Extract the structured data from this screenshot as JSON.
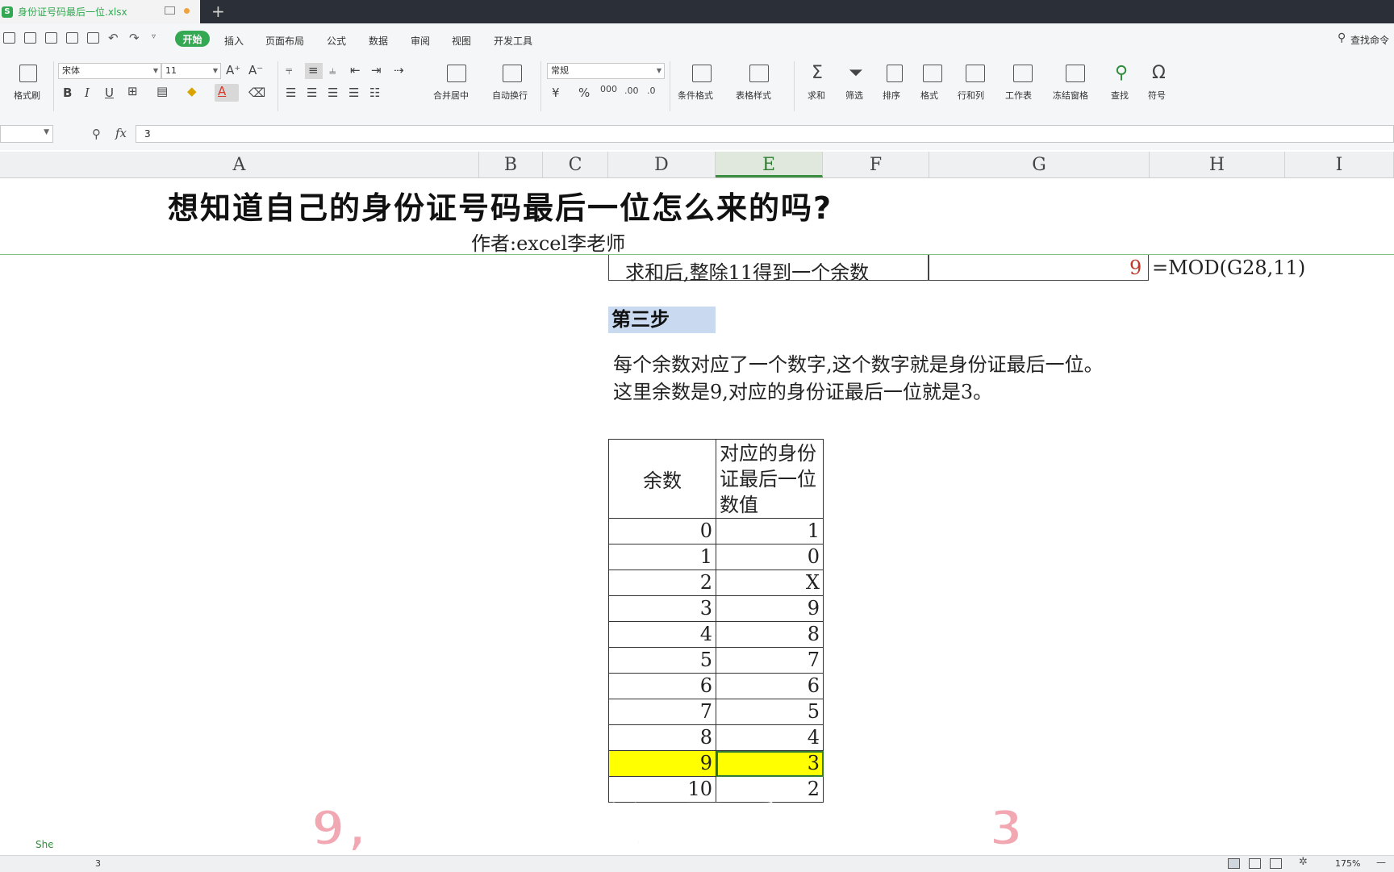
{
  "window": {
    "file_tab": "身份证号码最后一位.xlsx",
    "new_tab_icon": "plus-icon"
  },
  "menu": {
    "items": [
      "开始",
      "插入",
      "页面布局",
      "公式",
      "数据",
      "审阅",
      "视图",
      "开发工具"
    ],
    "search": "查找命令",
    "active_color": "#35a853"
  },
  "ribbon": {
    "format_painter": "格式刷",
    "font_name": "宋体",
    "font_size": "11",
    "number_format": "常规",
    "merge_center": "合并居中",
    "wrap_text": "自动换行",
    "conditional_format": "条件格式",
    "table_style": "表格样式",
    "sum": "求和",
    "filter": "筛选",
    "sort": "排序",
    "format": "格式",
    "row_col": "行和列",
    "worksheet": "工作表",
    "freeze": "冻结窗格",
    "find": "查找",
    "symbol": "符号"
  },
  "formula_bar": {
    "fx": "fx",
    "value": "3"
  },
  "columns": [
    "A",
    "B",
    "C",
    "D",
    "E",
    "F",
    "G",
    "H",
    "I"
  ],
  "sheet": {
    "title": "想知道自己的身份证号码最后一位怎么来的吗?",
    "author": "作者:excel李老师",
    "step_desc": "求和后,整除11得到一个余数",
    "step_result": "9",
    "step_formula": "=MOD(G28,11)",
    "step3_label": "第三步",
    "para1": "每个余数对应了一个数字,这个数字就是身份证最后一位。",
    "para2": "这里余数是9,对应的身份证最后一位就是3。",
    "table_header_remainder": "余数",
    "table_header_value": "对应的身份证最后一位数值",
    "rows": [
      {
        "remainder": "0",
        "value": "1"
      },
      {
        "remainder": "1",
        "value": "0"
      },
      {
        "remainder": "2",
        "value": "X"
      },
      {
        "remainder": "3",
        "value": "9"
      },
      {
        "remainder": "4",
        "value": "8"
      },
      {
        "remainder": "5",
        "value": "7"
      },
      {
        "remainder": "6",
        "value": "6"
      },
      {
        "remainder": "7",
        "value": "5"
      },
      {
        "remainder": "8",
        "value": "4"
      },
      {
        "remainder": "9",
        "value": "3"
      },
      {
        "remainder": "10",
        "value": "2"
      }
    ],
    "highlight_color": "#ffff00"
  },
  "bottom": {
    "sheet_tab": "She",
    "status_value": "3",
    "zoom": "175%"
  },
  "subtitle": "这里余数是9,对应的身份证最后一位就是3。"
}
